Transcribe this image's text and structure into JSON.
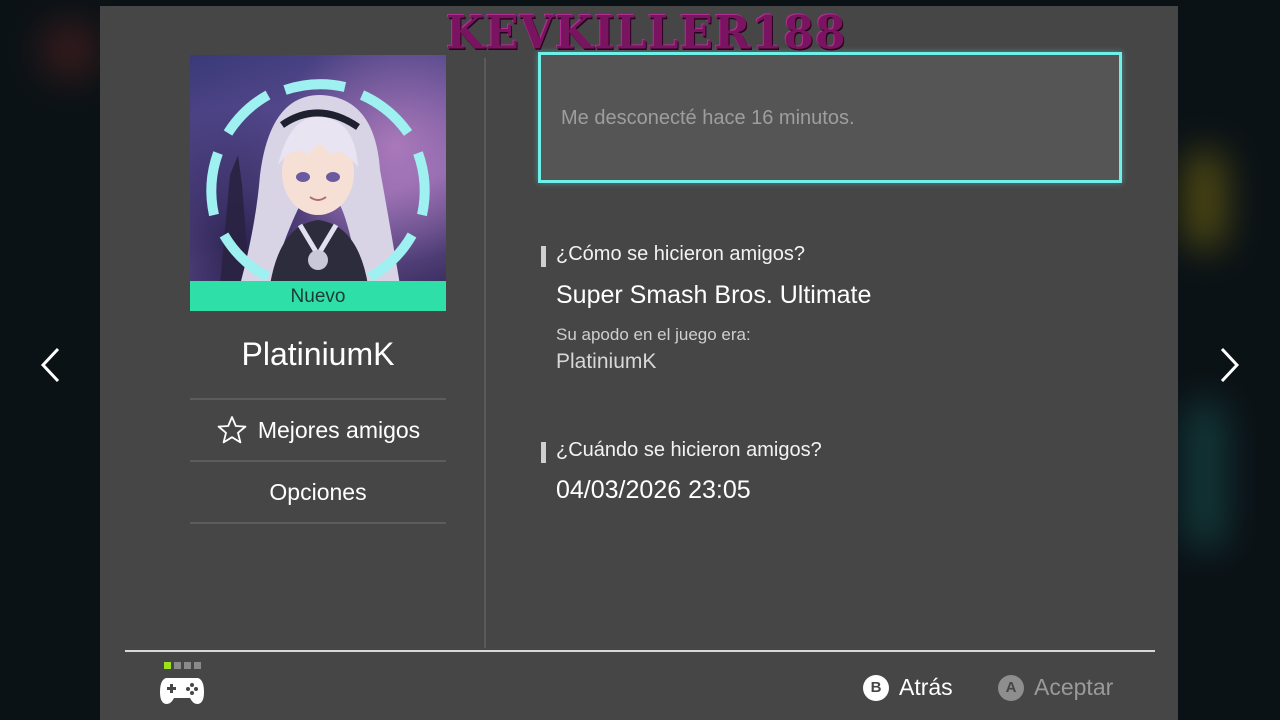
{
  "watermark": "KEVKILLER188",
  "profile": {
    "badge": "Nuevo",
    "username": "PlatiniumK",
    "menu": [
      {
        "label": "Mejores amigos",
        "icon": "star-outline-icon"
      },
      {
        "label": "Opciones"
      }
    ]
  },
  "status": {
    "text": "Me desconecté hace 16 minutos."
  },
  "how_met": {
    "heading": "¿Cómo se hicieron amigos?",
    "game": "Super Smash Bros. Ultimate",
    "nickname_label": "Su apodo en el juego era:",
    "nickname": "PlatiniumK"
  },
  "when_met": {
    "heading": "¿Cuándo se hicieron amigos?",
    "datetime": "04/03/2026 23:05"
  },
  "footer": {
    "back": {
      "key": "B",
      "label": "Atrás"
    },
    "accept": {
      "key": "A",
      "label": "Aceptar"
    }
  },
  "colors": {
    "accent_cyan": "#6ef0e8",
    "new_badge": "#2ee0a8",
    "panel": "#464646"
  }
}
